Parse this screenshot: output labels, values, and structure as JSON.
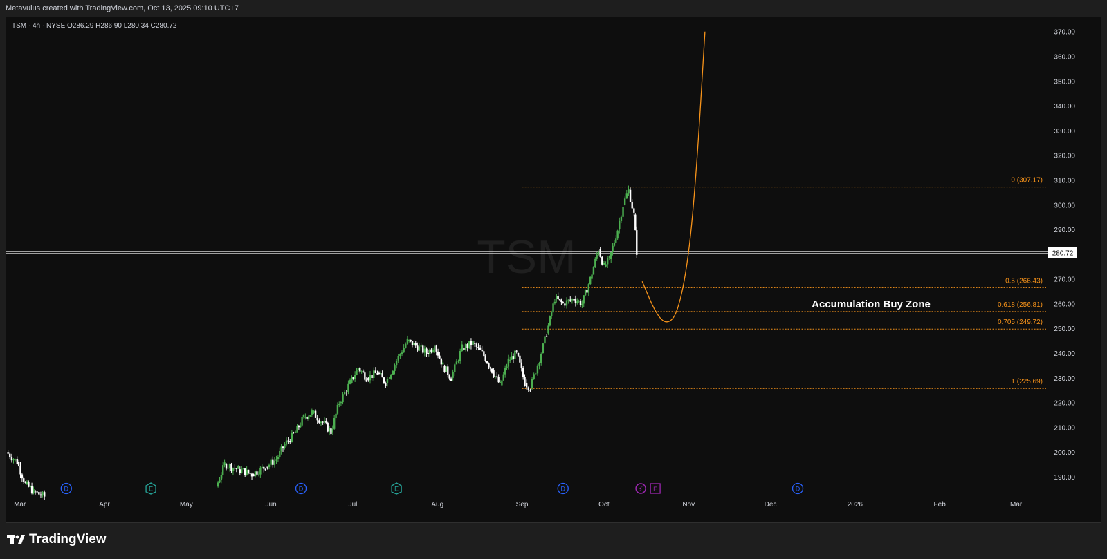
{
  "header": {
    "attribution": "Metavulus created with TradingView.com, Oct 13, 2025 09:10 UTC+7"
  },
  "symbol_info": "TSM · 4h · NYSE  O286.29  H286.90  L280.34  C280.72",
  "watermark": "TSM",
  "last_price_label": "280.72",
  "annotation": {
    "text": "Accumulation Buy Zone"
  },
  "footer": {
    "brand": "TradingView"
  },
  "colors": {
    "background": "#0e0e0e",
    "up_candle": "#4caf50",
    "down_candle": "#ffffff",
    "fib": "#f7931a",
    "projection": "#f7931a",
    "dividend": "#2962ff",
    "earnings": "#26a69a",
    "event_purple": "#9c27b0"
  },
  "chart_data": {
    "type": "candlestick",
    "symbol": "TSM",
    "interval": "4h",
    "exchange": "NYSE",
    "ohlc_last": {
      "open": 286.29,
      "high": 286.9,
      "low": 280.34,
      "close": 280.72
    },
    "ylim": [
      183,
      373
    ],
    "y_ticks": [
      190,
      200,
      210,
      220,
      230,
      240,
      250,
      260,
      270,
      280,
      290,
      300,
      310,
      320,
      330,
      340,
      350,
      360,
      370
    ],
    "y_tick_labels": [
      "190.00",
      "200.00",
      "210.00",
      "220.00",
      "230.00",
      "240.00",
      "250.00",
      "260.00",
      "270.00",
      "280.00",
      "290.00",
      "300.00",
      "310.00",
      "320.00",
      "330.00",
      "340.00",
      "350.00",
      "360.00",
      "370.00"
    ],
    "x_range": [
      "2025-02-24",
      "2026-03-12"
    ],
    "x_ticks": [
      {
        "label": "Mar",
        "date": "2025-03-01"
      },
      {
        "label": "Apr",
        "date": "2025-04-01"
      },
      {
        "label": "May",
        "date": "2025-05-01"
      },
      {
        "label": "Jun",
        "date": "2025-06-01"
      },
      {
        "label": "Jul",
        "date": "2025-07-01"
      },
      {
        "label": "Aug",
        "date": "2025-08-01"
      },
      {
        "label": "Sep",
        "date": "2025-09-01"
      },
      {
        "label": "Oct",
        "date": "2025-10-01"
      },
      {
        "label": "Nov",
        "date": "2025-11-01"
      },
      {
        "label": "Dec",
        "date": "2025-12-01"
      },
      {
        "label": "2026",
        "date": "2026-01-01"
      },
      {
        "label": "Feb",
        "date": "2026-02-01"
      },
      {
        "label": "Mar",
        "date": "2026-03-01"
      }
    ],
    "price_path": [
      [
        "2025-02-24",
        200
      ],
      [
        "2025-02-28",
        196
      ],
      [
        "2025-03-03",
        187
      ],
      [
        "2025-03-06",
        184
      ],
      [
        "2025-03-10",
        182
      ],
      [
        "2025-05-12",
        186
      ],
      [
        "2025-05-15",
        195
      ],
      [
        "2025-05-20",
        193
      ],
      [
        "2025-05-25",
        191
      ],
      [
        "2025-05-30",
        194
      ],
      [
        "2025-06-03",
        197
      ],
      [
        "2025-06-06",
        203
      ],
      [
        "2025-06-10",
        208
      ],
      [
        "2025-06-13",
        214
      ],
      [
        "2025-06-16",
        216
      ],
      [
        "2025-06-20",
        212
      ],
      [
        "2025-06-23",
        208
      ],
      [
        "2025-06-26",
        220
      ],
      [
        "2025-06-30",
        228
      ],
      [
        "2025-07-03",
        234
      ],
      [
        "2025-07-06",
        230
      ],
      [
        "2025-07-10",
        232
      ],
      [
        "2025-07-13",
        228
      ],
      [
        "2025-07-17",
        237
      ],
      [
        "2025-07-21",
        245
      ],
      [
        "2025-07-24",
        243
      ],
      [
        "2025-07-28",
        240
      ],
      [
        "2025-07-31",
        243
      ],
      [
        "2025-08-03",
        235
      ],
      [
        "2025-08-06",
        230
      ],
      [
        "2025-08-10",
        242
      ],
      [
        "2025-08-14",
        244
      ],
      [
        "2025-08-18",
        239
      ],
      [
        "2025-08-21",
        233
      ],
      [
        "2025-08-24",
        227
      ],
      [
        "2025-08-27",
        237
      ],
      [
        "2025-08-30",
        240
      ],
      [
        "2025-09-02",
        228
      ],
      [
        "2025-09-04",
        226
      ],
      [
        "2025-09-08",
        240
      ],
      [
        "2025-09-10",
        248
      ],
      [
        "2025-09-13",
        262
      ],
      [
        "2025-09-16",
        260
      ],
      [
        "2025-09-20",
        262
      ],
      [
        "2025-09-23",
        260
      ],
      [
        "2025-09-26",
        270
      ],
      [
        "2025-09-29",
        282
      ],
      [
        "2025-10-01",
        275
      ],
      [
        "2025-10-03",
        278
      ],
      [
        "2025-10-06",
        290
      ],
      [
        "2025-10-08",
        300
      ],
      [
        "2025-10-10",
        306
      ],
      [
        "2025-10-12",
        296
      ],
      [
        "2025-10-13",
        281
      ]
    ],
    "fib_levels": [
      {
        "label": "0 (307.17)",
        "value": 307.17
      },
      {
        "label": "0.5 (266.43)",
        "value": 266.43
      },
      {
        "label": "0.618 (256.81)",
        "value": 256.81
      },
      {
        "label": "0.705 (249.72)",
        "value": 249.72
      },
      {
        "label": "1 (225.69)",
        "value": 225.69
      }
    ],
    "fib_start_date": "2025-09-01",
    "last_price": 280.72,
    "projection_curve": [
      [
        "2025-10-15",
        269
      ],
      [
        "2025-10-20",
        256
      ],
      [
        "2025-10-24",
        251.5
      ],
      [
        "2025-10-28",
        256
      ],
      [
        "2025-11-01",
        278
      ],
      [
        "2025-11-04",
        315
      ],
      [
        "2025-11-07",
        370
      ]
    ],
    "event_markers": [
      {
        "type": "D",
        "date": "2025-03-18"
      },
      {
        "type": "E",
        "date": "2025-04-18"
      },
      {
        "type": "D",
        "date": "2025-06-12"
      },
      {
        "type": "E",
        "date": "2025-07-17"
      },
      {
        "type": "D",
        "date": "2025-09-16"
      },
      {
        "type": "split-earnings",
        "date": "2025-10-16"
      },
      {
        "type": "D",
        "date": "2025-12-11"
      }
    ]
  }
}
